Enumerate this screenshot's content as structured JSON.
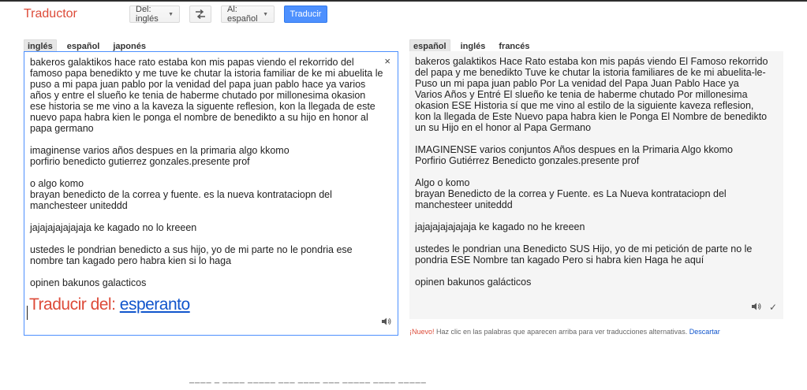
{
  "header": {
    "app_title": "Traductor",
    "from_button": "Del: inglés",
    "to_button": "Al: español",
    "translate_button": "Traducir"
  },
  "source": {
    "tabs": [
      "inglés",
      "español",
      "japonés"
    ],
    "paragraphs": [
      "bakeros galaktikos hace rato estaba kon mis papas viendo el rekorrido del famoso papa benedikto y me tuve ke chutar la istoria familiar de ke mi abuelita le puso a mi papa juan pablo por la venidad del papa juan pablo hace ya varios años y entre el slueño ke tenia de haberme chutado por millonesima okasion ese historia se me vino a la kaveza la siguente reflesion, kon la llegada de este nuevo papa habra kien le ponga el nombre de benedikto a su hijo en honor al papa germano",
      "imaginense varios años despues en la primaria algo kkomo\nporfirio benedicto gutierrez gonzales.presente prof",
      "o algo komo\nbrayan benedicto de la correa y fuente. es la nueva kontrataciopn del manchesteer uniteddd",
      "jajajajajajajaja ke kagado no lo kreeen",
      "ustedes le pondrian benedicto a sus hijo, yo de mi parte no le pondria ese nombre tan kagado pero habra kien si lo haga",
      "opinen bakunos galacticos"
    ],
    "suggestion_prefix": "Traducir del: ",
    "suggestion_lang": "esperanto",
    "clear_symbol": "×"
  },
  "target": {
    "tabs": [
      "español",
      "inglés",
      "francés"
    ],
    "paragraphs": [
      "bakeros galaktikos Hace Rato estaba kon mis papás viendo El Famoso rekorrido del papa y me benedikto Tuve ke chutar la istoria familiares de ke mi abuelita-le-Puso un mi papa juan pablo Por La venidad del Papa Juan Pablo Hace ya Varios Años y Entré El slueño ke tenia de haberme chutado Por millonesima okasion ESE Historia sí que me vino al estilo de la siguiente kaveza reflesion, kon la llegada de Este Nuevo papa habra kien le Ponga El Nombre de benedikto un su Hijo en el honor al Papa Germano",
      "IMAGINENSE varios conjuntos Años despues en la Primaria Algo kkomo\nPorfirio Gutiérrez Benedicto gonzales.presente prof",
      "Algo o komo\nbrayan Benedicto de la correa y Fuente. es La Nueva kontrataciopn del manchesteer uniteddd",
      "jajajajajajajaja ke kagado no he kreeen",
      "ustedes le pondrian una Benedicto SUS Hijo, yo de mi petición de parte no le pondria ESE Nombre tan kagado Pero si habra kien Haga he aquí",
      "opinen bakunos galácticos"
    ],
    "check_symbol": "✓"
  },
  "notice": {
    "new_label": "¡Nuevo!",
    "text": " Haz clic en las palabras que aparecen arriba para ver traducciones alternativas. ",
    "link": "Descartar"
  },
  "icons": {
    "swap": "swap-icon",
    "speaker": "speaker-icon",
    "close": "close-icon",
    "check": "check-icon"
  },
  "colors": {
    "brand": "#dd4b39",
    "accent_blue": "#4d90fe",
    "link": "#1155cc"
  }
}
